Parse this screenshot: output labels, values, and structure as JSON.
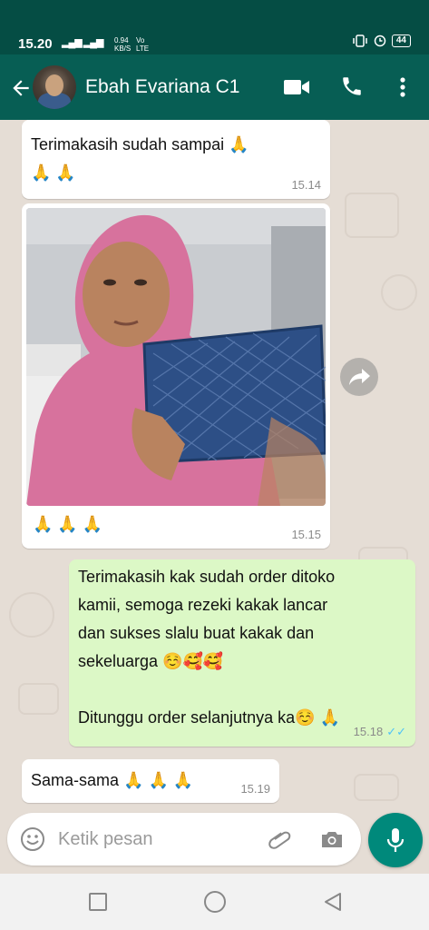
{
  "status_bar": {
    "time": "15.20",
    "signal": "▂▄▆ ▂▄▆",
    "speed_value": "0.94",
    "speed_unit": "KB/S",
    "network_top": "Vo",
    "network_bottom": "LTE",
    "battery": "44"
  },
  "header": {
    "contact_name": "Ebah Evariana C1",
    "icons": [
      "back-arrow-icon",
      "video-call-icon",
      "phone-icon",
      "more-vert-icon"
    ]
  },
  "messages": [
    {
      "direction": "in",
      "text": "Terimakasih sudah sampai 🙏\n🙏 🙏",
      "time": "15.14"
    },
    {
      "direction": "in",
      "type": "image",
      "caption": "🙏 🙏 🙏",
      "time": "15.15"
    },
    {
      "direction": "out",
      "text": "Terimakasih kak sudah order ditoko\nkamii, semoga rezeki kakak lancar\ndan sukses slalu buat kakak dan\nsekeluarga ☺️🥰🥰\n\nDitunggu order selanjutnya ka☺️ 🙏",
      "time": "15.18",
      "ticks": "✓✓"
    },
    {
      "direction": "in",
      "text": "Sama-sama 🙏 🙏 🙏",
      "time": "15.19"
    }
  ],
  "input": {
    "placeholder": "Ketik pesan"
  },
  "colors": {
    "header": "#075e54",
    "status_bar": "#054d44",
    "outgoing_bubble": "#dcf8c6",
    "incoming_bubble": "#ffffff",
    "accent": "#00897b",
    "read_ticks": "#4fc3f7"
  }
}
